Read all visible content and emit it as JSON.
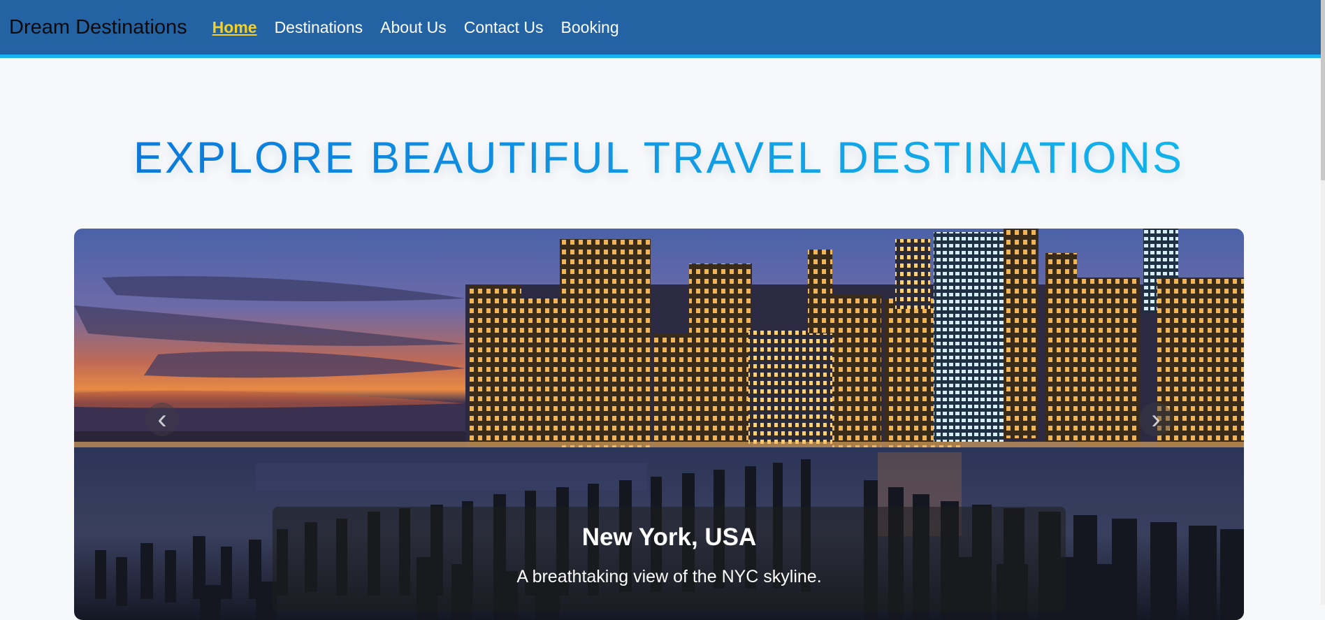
{
  "nav": {
    "brand": "Dream Destinations",
    "links": [
      "Home",
      "Destinations",
      "About Us",
      "Contact Us",
      "Booking"
    ],
    "active": "Home"
  },
  "hero": {
    "title": "EXPLORE BEAUTIFUL TRAVEL DESTINATIONS"
  },
  "carousel": {
    "slide": {
      "title": "New York, USA",
      "description": "A breathtaking view of the NYC skyline."
    },
    "prev_icon": "chevron-left-icon",
    "next_icon": "chevron-right-icon"
  },
  "colors": {
    "navbar": "#2463a3",
    "navbar_border": "#16b3f0",
    "active_link": "#f5d027",
    "title_gradient_start": "#0a74dc",
    "title_gradient_end": "#12bdf0"
  }
}
